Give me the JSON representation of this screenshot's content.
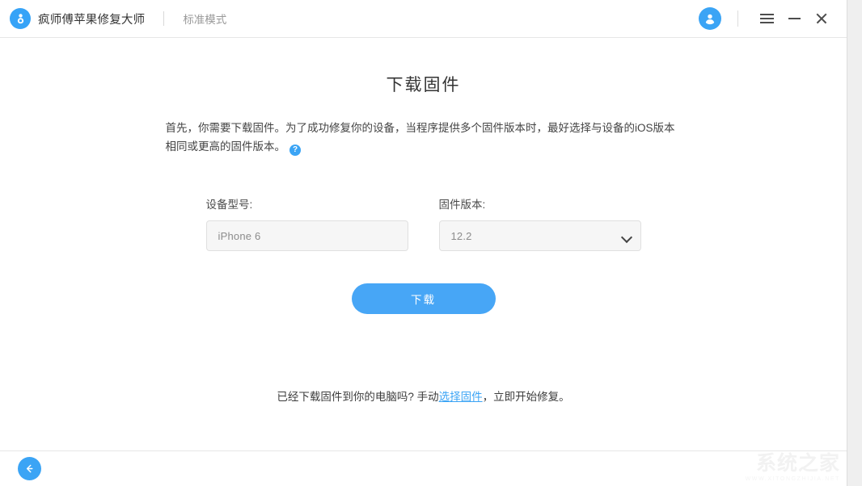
{
  "titlebar": {
    "logo_icon": "app-logo-icon",
    "brand_name": "疯师傅苹果修复大师",
    "mode_label": "标准模式",
    "avatar_icon": "user-avatar-icon",
    "menu_icon": "hamburger-menu-icon",
    "minimize_icon": "minimize-icon",
    "close_icon": "close-icon"
  },
  "main": {
    "page_title": "下载固件",
    "description_line1": "首先，你需要下载固件。为了成功修复你的设备，当程序提供多个固件版本时，最好选择与设备的iOS版本相",
    "description_line2": "同或更高的固件版本。",
    "help_icon_glyph": "?",
    "form": {
      "device_label": "设备型号:",
      "device_value": "iPhone 6",
      "firmware_label": "固件版本:",
      "firmware_value": "12.2",
      "firmware_options": [
        "12.2"
      ],
      "dropdown_icon": "chevron-down-icon"
    },
    "download_button": "下载",
    "hint_prefix": "已经下载固件到你的电脑吗? 手动",
    "hint_link": "选择固件",
    "hint_suffix": "，立即开始修复。"
  },
  "footer": {
    "back_icon": "arrow-left-icon",
    "watermark_main": "系统之家",
    "watermark_sub": "WWW.XITONGZHIJIA.NET"
  },
  "colors": {
    "accent": "#3ba4f5",
    "button": "#47a6f6",
    "field_bg": "#f6f6f6",
    "text": "#333333"
  }
}
